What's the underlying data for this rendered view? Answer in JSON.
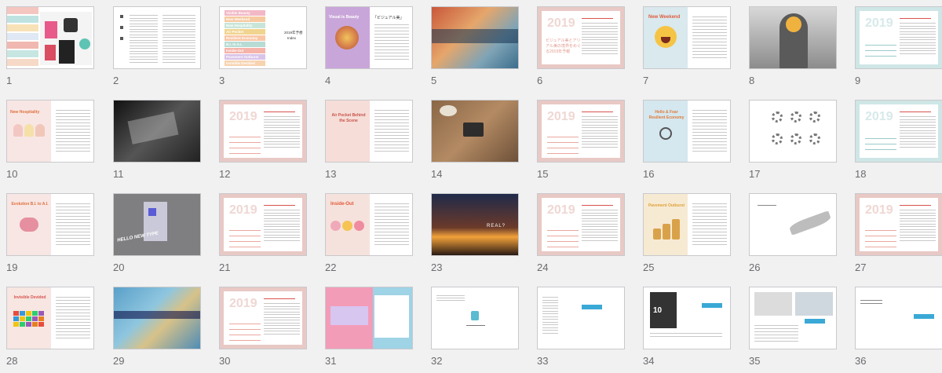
{
  "slides": [
    {
      "number": "1",
      "kind": "cover"
    },
    {
      "number": "2",
      "kind": "text"
    },
    {
      "number": "3",
      "kind": "toc",
      "items": [
        "Visible Beauty",
        "New Weekend",
        "New Hospitality",
        "Air Pocket",
        "Resilient Economy",
        "B.I. to A.I.",
        "Inside-Out",
        "Pavement Outburst",
        "Invisible Devided"
      ],
      "year": "2019年予想",
      "sub": "Index"
    },
    {
      "number": "4",
      "kind": "purple",
      "title": "Visual is Beauty",
      "caption": "「ビジュアル美」"
    },
    {
      "number": "5",
      "kind": "photo-food"
    },
    {
      "number": "6",
      "kind": "pink-text",
      "caption": "ビジュアル美とアリアル美の境界をめぐる2019年予報"
    },
    {
      "number": "7",
      "kind": "new-weekend",
      "title": "New Weekend"
    },
    {
      "number": "8",
      "kind": "photo-man"
    },
    {
      "number": "9",
      "kind": "teal-text"
    },
    {
      "number": "10",
      "kind": "hospitality",
      "title": "New Hospitality"
    },
    {
      "number": "11",
      "kind": "photo-dark"
    },
    {
      "number": "12",
      "kind": "pink-text"
    },
    {
      "number": "13",
      "kind": "airpocket",
      "title": "Air Pocket Behind the Scene"
    },
    {
      "number": "14",
      "kind": "photo-feet"
    },
    {
      "number": "15",
      "kind": "pink-text"
    },
    {
      "number": "16",
      "kind": "resilient",
      "title": "Hello & Fear Resilient Economy"
    },
    {
      "number": "17",
      "kind": "spinners"
    },
    {
      "number": "18",
      "kind": "teal-text"
    },
    {
      "number": "19",
      "kind": "evolution",
      "title": "Evolution B.I. to A.I."
    },
    {
      "number": "20",
      "kind": "photo-gray",
      "label": "HELLO NEW TYPE"
    },
    {
      "number": "21",
      "kind": "pink-text"
    },
    {
      "number": "22",
      "kind": "inside-out",
      "title": "Inside-Out"
    },
    {
      "number": "23",
      "kind": "photo-sunrise",
      "label": "REAL?"
    },
    {
      "number": "24",
      "kind": "pink-text"
    },
    {
      "number": "25",
      "kind": "pavement",
      "title": "Pavement Outburst"
    },
    {
      "number": "26",
      "kind": "hand"
    },
    {
      "number": "27",
      "kind": "pink-text"
    },
    {
      "number": "28",
      "kind": "invisible",
      "title": "Invisible Devided"
    },
    {
      "number": "29",
      "kind": "photo-map"
    },
    {
      "number": "30",
      "kind": "pink-text"
    },
    {
      "number": "31",
      "kind": "poster"
    },
    {
      "number": "32",
      "kind": "white-logo"
    },
    {
      "number": "33",
      "kind": "white-text"
    },
    {
      "number": "34",
      "kind": "book"
    },
    {
      "number": "35",
      "kind": "screens"
    },
    {
      "number": "36",
      "kind": "white-end"
    }
  ],
  "colors": {
    "background": "#f1f1f2",
    "thumb_border": "#c9c9cc",
    "number_text": "#6b6b6e",
    "pink_frame": "#e8c9c5",
    "teal_frame": "#cfe6e6",
    "purple": "#c9a6d9",
    "mustard": "#e0a23a"
  }
}
